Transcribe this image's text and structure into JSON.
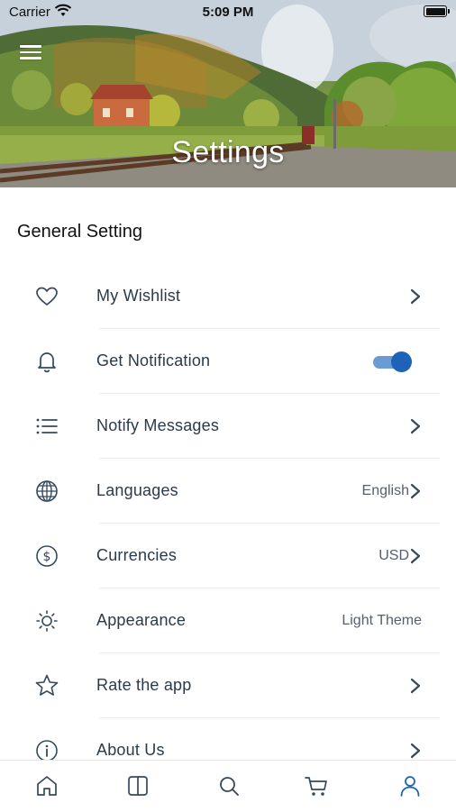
{
  "status_bar": {
    "carrier": "Carrier",
    "time": "5:09 PM"
  },
  "header": {
    "title": "Settings"
  },
  "section": {
    "title": "General Setting"
  },
  "settings": [
    {
      "label": "My Wishlist",
      "icon": "heart-icon",
      "value": "",
      "control": "chevron"
    },
    {
      "label": "Get Notification",
      "icon": "bell-icon",
      "value": "",
      "control": "toggle",
      "toggle_on": true
    },
    {
      "label": "Notify Messages",
      "icon": "list-icon",
      "value": "",
      "control": "chevron"
    },
    {
      "label": "Languages",
      "icon": "globe-icon",
      "value": "English",
      "control": "chevron"
    },
    {
      "label": "Currencies",
      "icon": "dollar-icon",
      "value": "USD",
      "control": "chevron"
    },
    {
      "label": "Appearance",
      "icon": "sun-icon",
      "value": "Light Theme",
      "control": "none"
    },
    {
      "label": "Rate the app",
      "icon": "star-icon",
      "value": "",
      "control": "chevron"
    },
    {
      "label": "About Us",
      "icon": "info-icon",
      "value": "",
      "control": "chevron"
    }
  ],
  "tabbar": {
    "tabs": [
      "home-icon",
      "split-view-icon",
      "search-icon",
      "cart-icon",
      "profile-icon"
    ],
    "active": "profile-icon"
  },
  "colors": {
    "accent": "#1e63b8",
    "toggle_track": "#6a9bd3",
    "icon": "#34495e",
    "active_tab": "#1e63b8"
  }
}
